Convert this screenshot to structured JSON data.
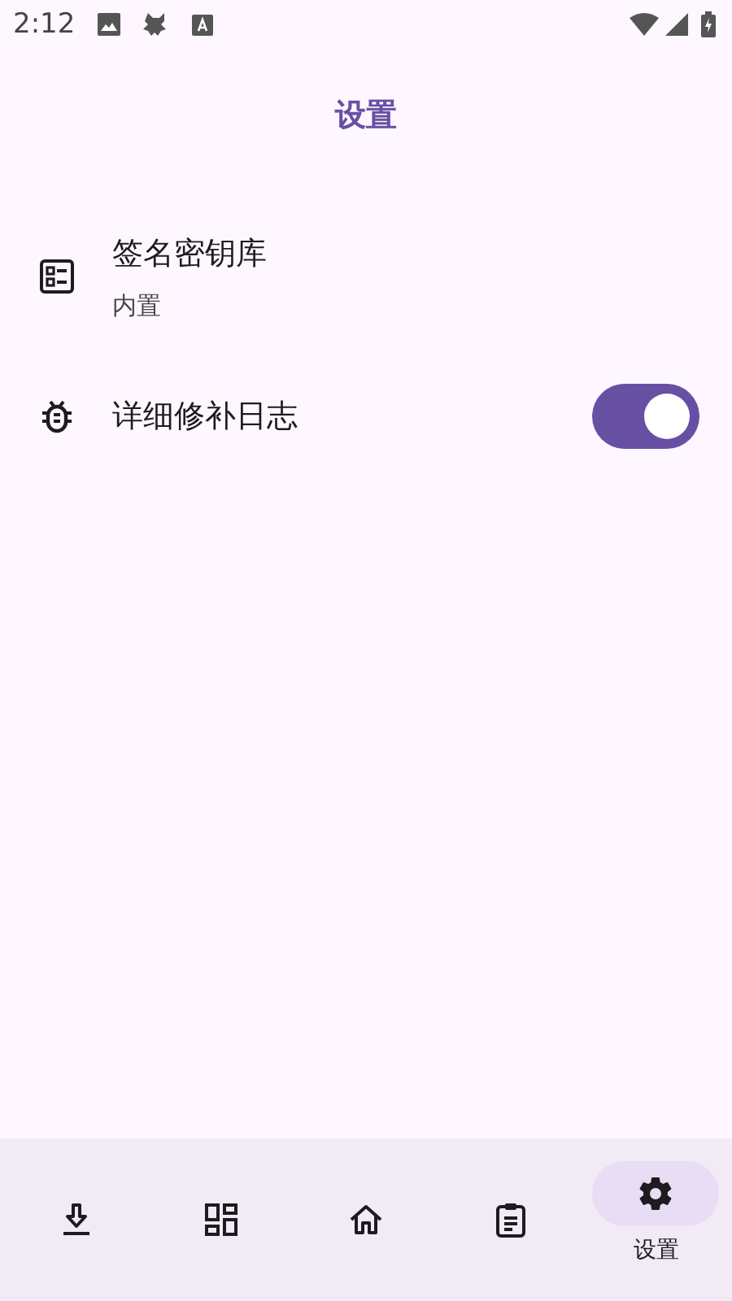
{
  "status_bar": {
    "time": "2:12"
  },
  "title": "设置",
  "settings": [
    {
      "kind": "value",
      "title": "签名密钥库",
      "value": "内置"
    },
    {
      "kind": "switch",
      "title": "详细修补日志",
      "on": true
    }
  ],
  "nav": [
    {
      "selected": false
    },
    {
      "selected": false
    },
    {
      "selected": false
    },
    {
      "selected": false
    },
    {
      "label": "设置",
      "selected": true
    }
  ]
}
